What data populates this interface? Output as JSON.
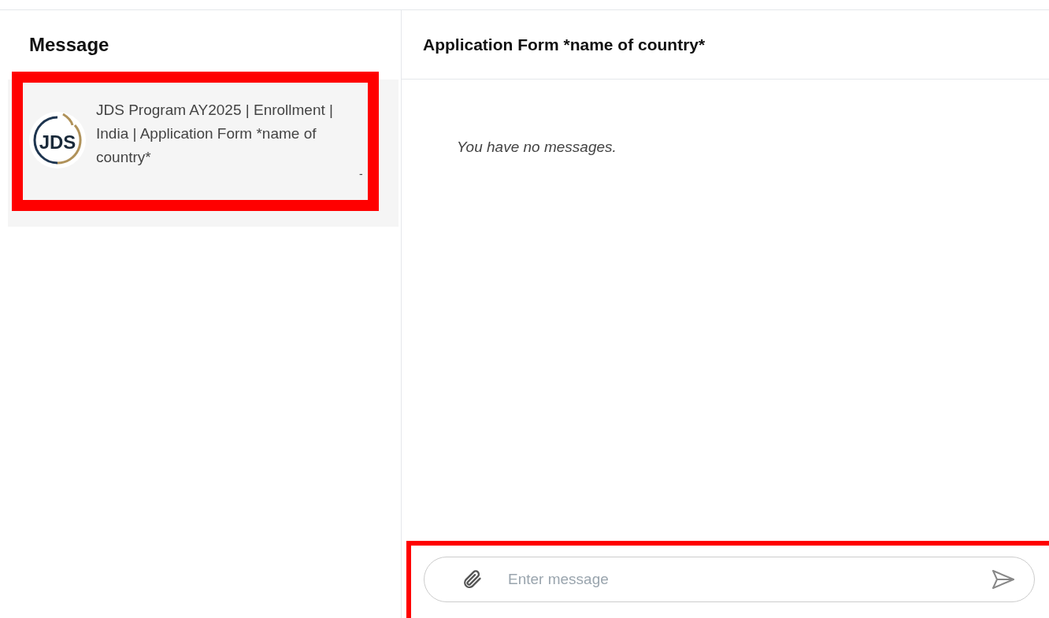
{
  "conversation_list": {
    "title": "Message",
    "items": [
      {
        "logo_text": "JDS",
        "title": "JDS Program AY2025 | Enrollment | India | Application Form *name of country*",
        "time": "-",
        "selected": true,
        "highlighted": true
      }
    ]
  },
  "chat": {
    "title": "Application Form *name of country*",
    "empty_text": "You have no messages.",
    "composer": {
      "placeholder": "Enter message",
      "highlighted": true
    }
  }
}
